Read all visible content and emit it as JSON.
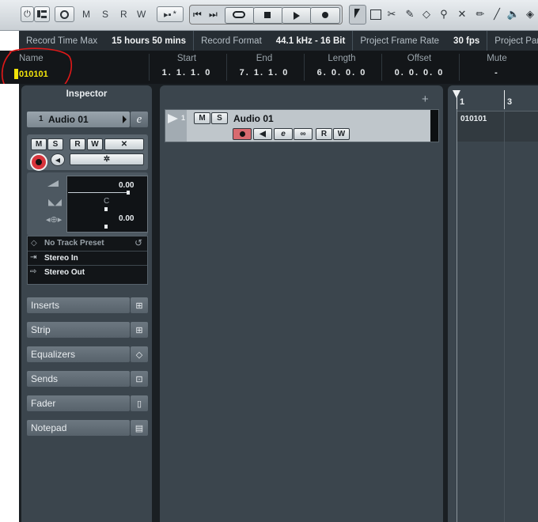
{
  "toolbar": {
    "activate_label": "⏻",
    "m_label": "M",
    "s_label": "S",
    "r_label": "R",
    "w_label": "W",
    "auto_label": "*"
  },
  "infobar": {
    "items": [
      {
        "label": "Record Time Max",
        "value": "15 hours 50 mins"
      },
      {
        "label": "Record Format",
        "value": "44.1 kHz - 16 Bit"
      },
      {
        "label": "Project Frame Rate",
        "value": "30 fps"
      },
      {
        "label": "Project Pan Law",
        "value": ""
      }
    ]
  },
  "eventline": {
    "name_header": "Name",
    "name_value": "010101",
    "columns": [
      {
        "header": "Start",
        "value": "1. 1. 1.  0"
      },
      {
        "header": "End",
        "value": "7. 1. 1.  0"
      },
      {
        "header": "Length",
        "value": "6. 0. 0.  0"
      },
      {
        "header": "Offset",
        "value": "0. 0. 0.  0"
      },
      {
        "header": "Mute",
        "value": "-"
      }
    ]
  },
  "inspector": {
    "title": "Inspector",
    "track_number": "1",
    "track_name": "Audio 01",
    "buttons": {
      "m": "M",
      "s": "S",
      "r": "R",
      "w": "W"
    },
    "volume_value": "0.00",
    "pan_value": "C",
    "delay_value": "0.00",
    "preset_label": "No Track Preset",
    "input_routing": "Stereo In",
    "output_routing": "Stereo Out",
    "sections": [
      "Inserts",
      "Strip",
      "Equalizers",
      "Sends",
      "Fader",
      "Notepad"
    ]
  },
  "tracklist": {
    "add_label": "+",
    "track_number": "1",
    "track_name": "Audio 01",
    "m_label": "M",
    "s_label": "S",
    "r_label": "R",
    "w_label": "W",
    "e_label": "e"
  },
  "project": {
    "ruler_labels": [
      "1",
      "3"
    ],
    "event_name": "010101"
  },
  "colors": {
    "record_red": "#d8343c",
    "selection_yellow": "#f2e40a",
    "annotation_red": "#e01818"
  }
}
